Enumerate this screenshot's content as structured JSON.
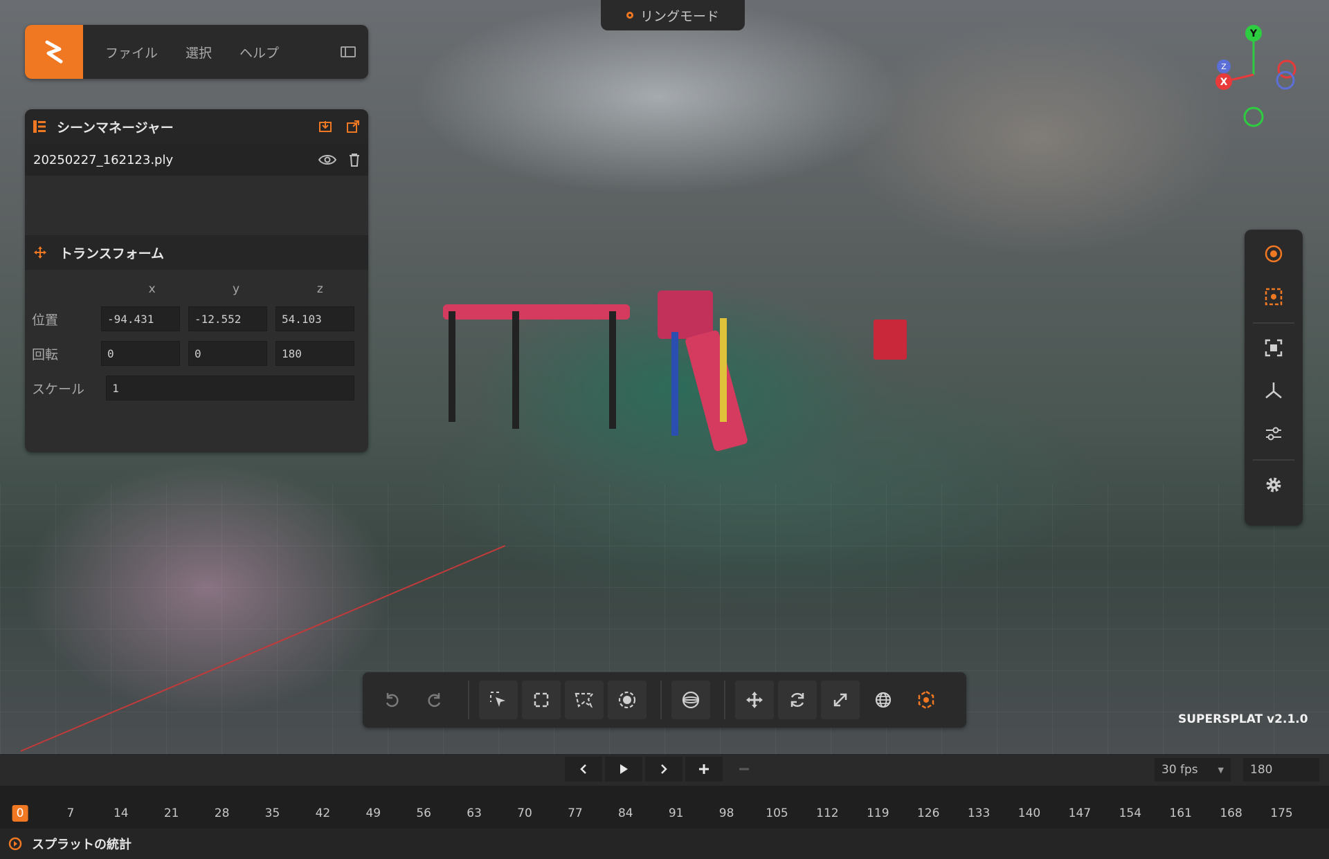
{
  "menu": {
    "file": "ファイル",
    "select": "選択",
    "help": "ヘルプ"
  },
  "mode": {
    "label": "リングモード"
  },
  "scene_manager": {
    "title": "シーンマネージャー",
    "file_name": "20250227_162123.ply"
  },
  "transform": {
    "title": "トランスフォーム",
    "columns": [
      "x",
      "y",
      "z"
    ],
    "position": {
      "label": "位置",
      "x": "-94.431",
      "y": "-12.552",
      "z": "54.103"
    },
    "rotation": {
      "label": "回転",
      "x": "0",
      "y": "0",
      "z": "180"
    },
    "scale": {
      "label": "スケール",
      "value": "1"
    }
  },
  "gizmo": {
    "x": "X",
    "y": "Y",
    "z": "Z"
  },
  "version": "SUPERSPLAT v2.1.0",
  "timeline": {
    "fps": "30 fps",
    "frames": "180",
    "ticks": [
      "0",
      "7",
      "14",
      "21",
      "28",
      "35",
      "42",
      "49",
      "56",
      "63",
      "70",
      "77",
      "84",
      "91",
      "98",
      "105",
      "112",
      "119",
      "126",
      "133",
      "140",
      "147",
      "154",
      "161",
      "168",
      "175"
    ],
    "current": "0"
  },
  "stats": {
    "label": "スプラットの統計"
  },
  "colors": {
    "accent": "#f07823",
    "panel": "#2a2a2a",
    "axis_x": "#e83a3a",
    "axis_y": "#2ecc40",
    "axis_z": "#5b6fd6"
  },
  "icons": {
    "logo": "supersplat-logo",
    "undo": "undo-icon",
    "redo": "redo-icon",
    "picker": "picker-icon",
    "lasso": "lasso-icon",
    "polygon": "polygon-icon",
    "brush": "brush-icon",
    "sphere": "sphere-icon",
    "move": "move-icon",
    "rotate": "rotate-icon",
    "scale": "scale-icon",
    "world": "world-icon",
    "pivot": "pivot-icon"
  }
}
